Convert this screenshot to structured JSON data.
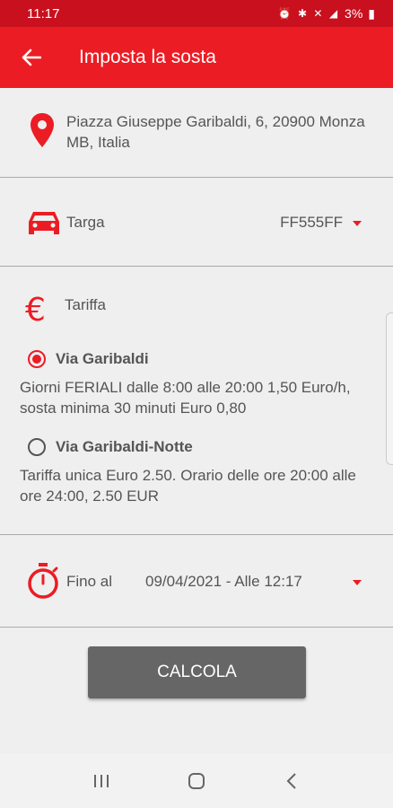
{
  "status_bar": {
    "time": "11:17",
    "battery": "3%"
  },
  "app_bar": {
    "title": "Imposta la sosta"
  },
  "address": {
    "text": "Piazza Giuseppe Garibaldi, 6, 20900 Monza MB, Italia"
  },
  "targa": {
    "label": "Targa",
    "value": "FF555FF"
  },
  "tariffa": {
    "label": "Tariffa",
    "options": [
      {
        "title": "Via Garibaldi",
        "description": "Giorni FERIALI dalle 8:00 alle 20:00 1,50 Euro/h, sosta minima 30 minuti Euro 0,80",
        "selected": true
      },
      {
        "title": "Via Garibaldi-Notte",
        "description": "Tariffa unica Euro 2.50. Orario delle ore 20:00 alle ore 24:00, 2.50 EUR",
        "selected": false
      }
    ]
  },
  "fino": {
    "label": "Fino al",
    "value": "09/04/2021 - Alle 12:17"
  },
  "actions": {
    "calcola_label": "CALCOLA"
  },
  "colors": {
    "accent": "#ec1c24",
    "status_bar": "#c8101e",
    "button": "#666666"
  }
}
